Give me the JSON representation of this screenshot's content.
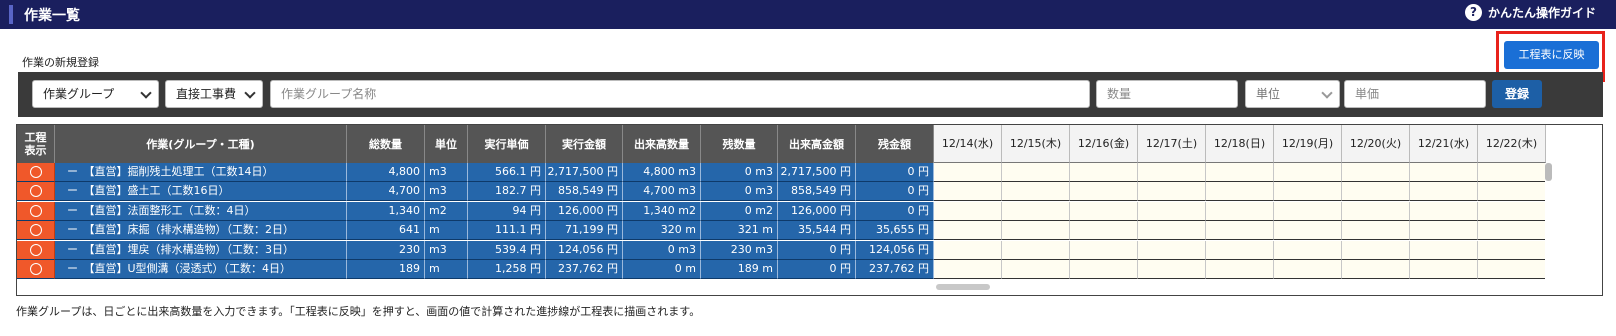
{
  "header": {
    "title": "作業一覧",
    "guide_label": "かんたん操作ガイド",
    "guide_icon": "?"
  },
  "section_label": "作業の新規登録",
  "reflect_button": "工程表に反映",
  "form": {
    "group_select": "作業グループ",
    "cost_select": "直接工事費",
    "name_placeholder": "作業グループ名称",
    "qty_placeholder": "数量",
    "unit_select": "単位",
    "price_placeholder": "単価",
    "register_button": "登録"
  },
  "table": {
    "columns": {
      "flag": "工程\n表示",
      "work": "作業(グループ・工種)",
      "total_qty": "総数量",
      "unit": "単位",
      "unit_price": "実行単価",
      "exec_amount": "実行金額",
      "done_qty": "出来高数量",
      "remain_qty": "残数量",
      "done_amount": "出来高金額",
      "remain_amount": "残金額"
    },
    "dates": [
      "12/14(水)",
      "12/15(木)",
      "12/16(金)",
      "12/17(土)",
      "12/18(日)",
      "12/19(月)",
      "12/20(火)",
      "12/21(水)",
      "12/22(木)"
    ],
    "rows": [
      {
        "name": "ー　【直営】掘削残土処理工（工数14日）",
        "total_qty": "4,800",
        "unit": "m3",
        "unit_price": "566.1 円",
        "exec_amount": "2,717,500 円",
        "done_qty": "4,800 m3",
        "remain_qty": "0 m3",
        "done_amount": "2,717,500 円",
        "remain_amount": "0 円"
      },
      {
        "name": "ー　【直営】盛土工（工数16日）",
        "total_qty": "4,700",
        "unit": "m3",
        "unit_price": "182.7 円",
        "exec_amount": "858,549 円",
        "done_qty": "4,700 m3",
        "remain_qty": "0 m3",
        "done_amount": "858,549 円",
        "remain_amount": "0 円"
      },
      {
        "name": "ー　【直営】法面整形工（工数：4日）",
        "total_qty": "1,340",
        "unit": "m2",
        "unit_price": "94 円",
        "exec_amount": "126,000 円",
        "done_qty": "1,340 m2",
        "remain_qty": "0 m2",
        "done_amount": "126,000 円",
        "remain_amount": "0 円"
      },
      {
        "name": "ー　【直営】床掘（排水構造物）（工数：2日）",
        "total_qty": "641",
        "unit": "m",
        "unit_price": "111.1 円",
        "exec_amount": "71,199 円",
        "done_qty": "320 m",
        "remain_qty": "321 m",
        "done_amount": "35,544 円",
        "remain_amount": "35,655 円"
      },
      {
        "name": "ー　【直営】埋戻（排水構造物）（工数：3日）",
        "total_qty": "230",
        "unit": "m3",
        "unit_price": "539.4 円",
        "exec_amount": "124,056 円",
        "done_qty": "0 m3",
        "remain_qty": "230 m3",
        "done_amount": "0 円",
        "remain_amount": "124,056 円"
      },
      {
        "name": "ー　【直営】U型側溝（浸透式）（工数：4日）",
        "total_qty": "189",
        "unit": "m",
        "unit_price": "1,258 円",
        "exec_amount": "237,762 円",
        "done_qty": "0 m",
        "remain_qty": "189 m",
        "done_amount": "0 円",
        "remain_amount": "237,762 円"
      }
    ]
  },
  "footnote": "作業グループは、日ごとに出来高数量を入力できます。「工程表に反映」を押すと、画面の値で計算された進捗線が工程表に描画されます。",
  "colors": {
    "titlebar": "#1a1f5e",
    "row_blue": "#2566aa",
    "flag_orange": "#f0582a",
    "highlight_red": "#e8221b",
    "button_blue": "#1a6fd6"
  }
}
